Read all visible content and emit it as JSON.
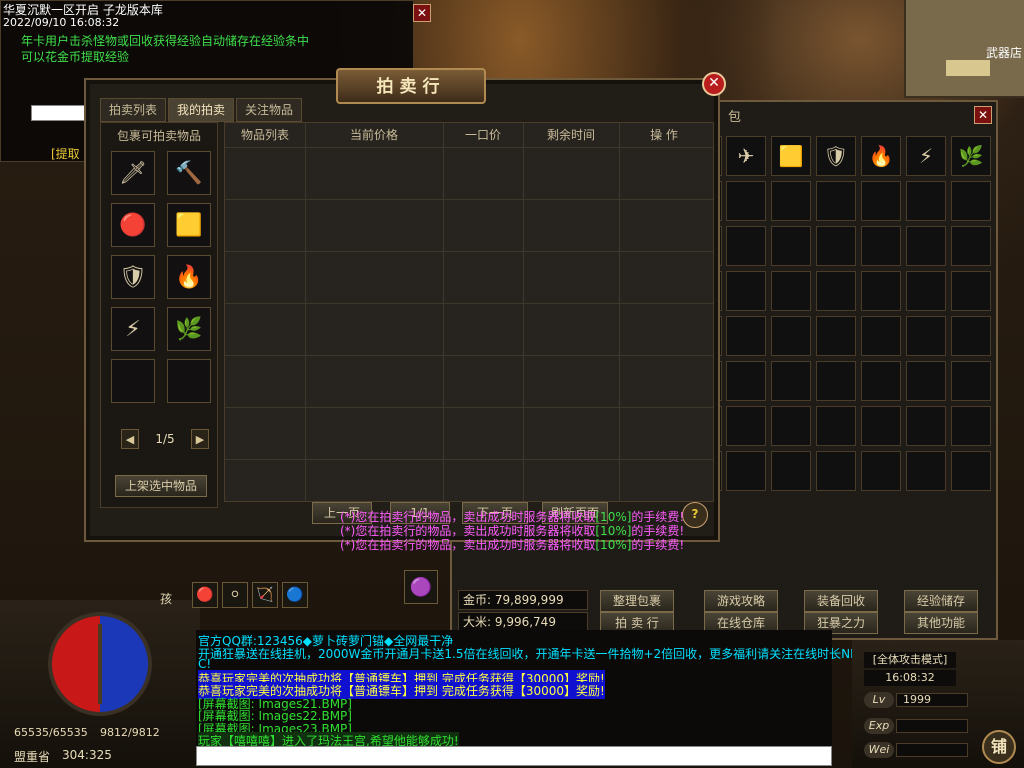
{
  "info": {
    "title": "华夏沉默一区开启 子龙版本库",
    "datetime": "2022/09/10 16:08:32",
    "line1": "年卡用户击杀怪物或回收获得经验自动储存在经验条中",
    "line2": "可以花金币提取经验",
    "link": "[提取"
  },
  "minimap": {
    "shop_label": "武器店"
  },
  "auction": {
    "title": "拍卖行",
    "close": "✕",
    "tabs": [
      "拍卖列表",
      "我的拍卖",
      "关注物品"
    ],
    "left_header": "包裹可拍卖物品",
    "page": "1/5",
    "list_button": "上架选中物品",
    "columns": [
      "物品列表",
      "当前价格",
      "一口价",
      "剩余时间",
      "操 作"
    ],
    "bottom_buttons": [
      "上一页",
      "1/1",
      "下一页",
      "刷新页面"
    ],
    "help": "?",
    "messages": [
      {
        "pre": "(*)您在拍卖行的物品，卖出成功时服务器将收取",
        "pct": "[10%]",
        "post": "的手续费!"
      },
      {
        "pre": "(*)您在拍卖行的物品，卖出成功时服务器将收取",
        "pct": "[10%]",
        "post": "的手续费!"
      },
      {
        "pre": "(*)您在拍卖行的物品，卖出成功时服务器将收取",
        "pct": "[10%]",
        "post": "的手续费!"
      }
    ],
    "items": [
      "🗡",
      "🔨",
      "🔴",
      "🟨",
      "🛡",
      "🔥",
      "⚡",
      "🌿",
      "",
      ""
    ]
  },
  "bag": {
    "title": "包",
    "close": "✕",
    "gold_label": "金币:",
    "gold_value": "79,899,999",
    "rice_label": "大米:",
    "rice_value": "9,996,749",
    "buttons": [
      "整理包裹",
      "游戏攻略",
      "装备回收",
      "经验储存",
      "拍 卖 行",
      "在线仓库",
      "狂暴之力",
      "其他功能"
    ],
    "first_row": [
      "✈",
      "🟨",
      "🛡",
      "🔥",
      "⚡",
      "🌿"
    ]
  },
  "hud": {
    "hp": "65535/65535",
    "mp": "9812/9812",
    "location": "盟重省",
    "coords": "304:325",
    "mode": "[全体攻击模式]",
    "time": "16:08:32",
    "lv_label": "Lv",
    "lv_value": "1999",
    "exp_label": "Exp",
    "wei_label": "Wei",
    "shop": "铺",
    "skill_label": "孩"
  },
  "chat": [
    {
      "text": "官方QQ群:123456◆萝卜砖萝门锚◆全网最干净",
      "color": "#00e0ff",
      "bg": ""
    },
    {
      "text": "开通狂暴送在线挂机，2000W金币开通月卡送1.5倍在线回收，开通年卡送一件拾物+2倍回收，更多福利请关注在线时长NP",
      "color": "#00e0ff",
      "bg": ""
    },
    {
      "text": "C!",
      "color": "#00e0ff",
      "bg": ""
    },
    {
      "text": "恭喜玩家完美的次抽成功将【普通镖车】押到 完成任务获得【30000】奖励!",
      "color": "#ffff40",
      "bg": "#1010d0"
    },
    {
      "text": "恭喜玩家完美的次抽成功将【普通镖车】押到 完成任务获得【30000】奖励!",
      "color": "#ffff40",
      "bg": "#1010d0"
    },
    {
      "text": "[屏幕截图: Images21.BMP]",
      "color": "#30e030",
      "bg": ""
    },
    {
      "text": "[屏幕截图: Images22.BMP]",
      "color": "#30e030",
      "bg": ""
    },
    {
      "text": "[屏幕截图: Images23.BMP]",
      "color": "#30e030",
      "bg": ""
    },
    {
      "text": "玩家【嘻嘻嘻】进入了玛法王宫,希望他能够成功!",
      "color": "#30e030",
      "bg": "#103010"
    }
  ]
}
